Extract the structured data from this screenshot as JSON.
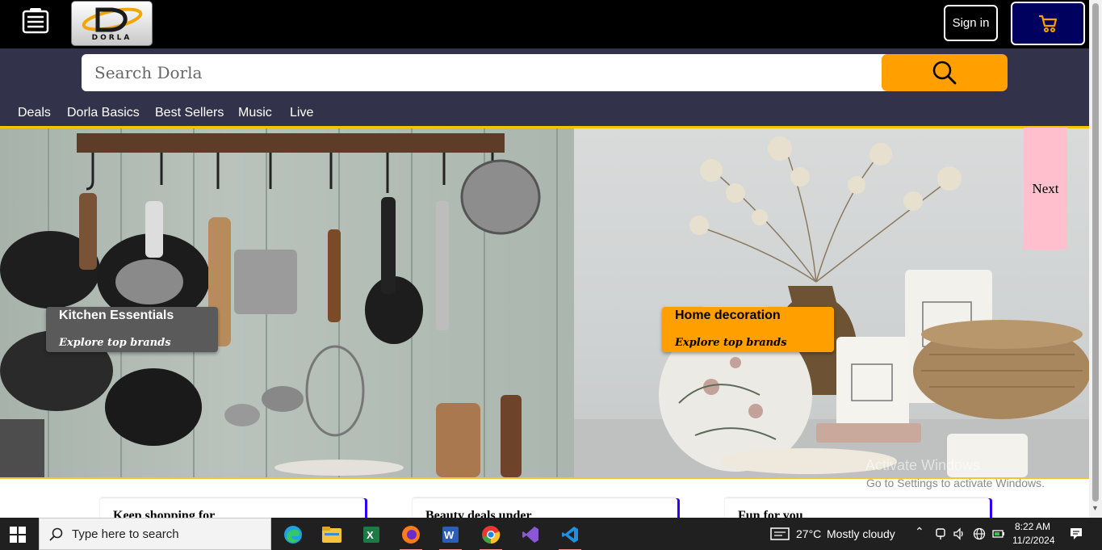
{
  "header": {
    "logo_text": "DORLA",
    "signin_label": "Sign in",
    "cart_icon": "cart-icon",
    "menu_icon": "menu-icon"
  },
  "search": {
    "placeholder": "Search Dorla",
    "button_icon": "search-icon"
  },
  "nav": {
    "items": [
      {
        "label": "Deals"
      },
      {
        "label": "Dorla Basics"
      },
      {
        "label": "Best Sellers"
      },
      {
        "label": "Music"
      },
      {
        "label": "Live"
      }
    ]
  },
  "hero": {
    "cards": [
      {
        "title": "Kitchen Essentials",
        "subtitle": "Explore top brands"
      },
      {
        "title": "Home decoration",
        "subtitle": "Explore top brands"
      }
    ],
    "next_label": "Next"
  },
  "watermark": {
    "line1": "Activate Windows",
    "line2": "Go to Settings to activate Windows."
  },
  "shop_cards": [
    {
      "title": "Keep shopping for"
    },
    {
      "title": "Beauty deals under"
    },
    {
      "title": "Fun for you"
    }
  ],
  "taskbar": {
    "search_placeholder": "Type here to search",
    "weather_temp": "27°C",
    "weather_text": "Mostly cloudy",
    "time": "8:22 AM",
    "date": "11/2/2024",
    "apps": [
      "edge-icon",
      "file-explorer-icon",
      "excel-icon",
      "firefox-icon",
      "word-icon",
      "chrome-icon",
      "visual-studio-icon",
      "vscode-icon"
    ]
  },
  "colors": {
    "topbar": "#000000",
    "band": "#32324a",
    "accent_orange": "#ff9f00",
    "cart_bg": "#00005e",
    "next_pink": "#ffbfcc",
    "nav_underline": "#f5c400"
  }
}
